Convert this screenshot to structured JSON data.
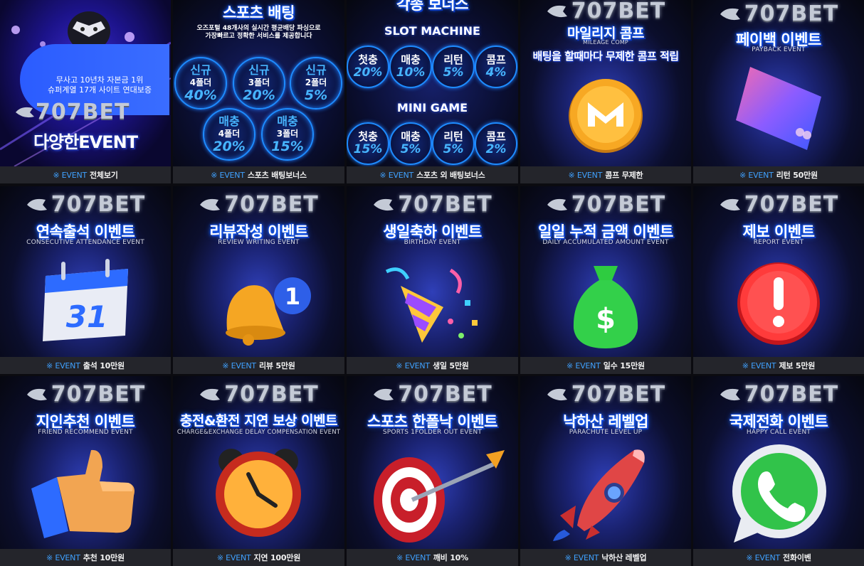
{
  "brand": "707BET",
  "caption_prefix": "※ EVENT",
  "colors": {
    "accent": "#3fa1ff",
    "caption_bg": "#24252b",
    "glow": "#1d6bff"
  },
  "cards": [
    {
      "id": "all",
      "caption": "전체보기",
      "promo_line1": "무사고 10년차 자본금 1위",
      "promo_line2": "슈퍼계열 17개 사이트 연대보증",
      "promo_title": "다양한EVENT",
      "icon": "masked-figure-icon"
    },
    {
      "id": "sports",
      "caption": "스포츠 배팅보너스",
      "title": "스포츠 배팅",
      "desc_line1": "오즈포털 48개사의 실시간 평균배당 파싱으로",
      "desc_line2": "가장빠르고 정확한 서비스를 제공합니다",
      "bonuses": [
        {
          "label": "신규",
          "folder": "4폴더",
          "pct": "40%"
        },
        {
          "label": "신규",
          "folder": "3폴더",
          "pct": "20%"
        },
        {
          "label": "신규",
          "folder": "2폴더",
          "pct": "5%"
        },
        {
          "label": "매충",
          "folder": "4폴더",
          "pct": "20%"
        },
        {
          "label": "매충",
          "folder": "3폴더",
          "pct": "15%"
        }
      ]
    },
    {
      "id": "casino",
      "caption": "스포츠 외 배팅보너스",
      "title": "각종 보너스",
      "slot_label": "SLOT MACHINE",
      "mini_label": "MINI GAME",
      "slot": [
        {
          "label": "첫충",
          "pct": "20%"
        },
        {
          "label": "매충",
          "pct": "10%"
        },
        {
          "label": "리턴",
          "pct": "5%"
        },
        {
          "label": "콤프",
          "pct": "4%"
        }
      ],
      "mini": [
        {
          "label": "첫충",
          "pct": "15%"
        },
        {
          "label": "매충",
          "pct": "5%"
        },
        {
          "label": "리턴",
          "pct": "5%"
        },
        {
          "label": "콤프",
          "pct": "2%"
        }
      ]
    },
    {
      "id": "comp",
      "caption": "콤프 무제한",
      "title": "마일리지 콤프",
      "subtitle": "MILEAGE COMP",
      "tagline": "배팅을 할때마다 무제한 콤프 적립",
      "icon": "coin-icon"
    },
    {
      "id": "payback",
      "caption": "리턴 50만원",
      "title": "페이백 이벤트",
      "subtitle": "PAYBACK EVENT",
      "icon": "credit-card-icon"
    },
    {
      "id": "attendance",
      "caption": "출석 10만원",
      "title": "연속출석 이벤트",
      "subtitle": "CONSECUTIVE ATTENDANCE EVENT",
      "icon": "calendar-icon",
      "calendar_day": "31"
    },
    {
      "id": "review",
      "caption": "리뷰 5만원",
      "title": "리뷰작성 이벤트",
      "subtitle": "REVIEW WRITING EVENT",
      "icon": "bell-icon",
      "badge": "1"
    },
    {
      "id": "birthday",
      "caption": "생일 5만원",
      "title": "생일축하 이벤트",
      "subtitle": "BIRTHDAY EVENT",
      "icon": "party-popper-icon"
    },
    {
      "id": "daily",
      "caption": "일수 15만원",
      "title": "일일 누적 금액 이벤트",
      "subtitle": "DAILY ACCUMULATED AMOUNT EVENT",
      "icon": "money-bag-icon"
    },
    {
      "id": "report",
      "caption": "제보 5만원",
      "title": "제보 이벤트",
      "subtitle": "REPORT EVENT",
      "icon": "alert-icon"
    },
    {
      "id": "friend",
      "caption": "추천 10만원",
      "title": "지인추천 이벤트",
      "subtitle": "FRIEND RECOMMEND EVENT",
      "icon": "thumbs-up-icon"
    },
    {
      "id": "delay",
      "caption": "지연 100만원",
      "title": "충전&환전 지연 보상 이벤트",
      "subtitle": "CHARGE&EXCHANGE DELAY COMPENSATION EVENT",
      "icon": "alarm-clock-icon"
    },
    {
      "id": "onefolder",
      "caption": "깨비 10%",
      "title": "스포츠 한폴낙 이벤트",
      "subtitle": "SPORTS 1FOLDER OUT EVENT",
      "icon": "target-icon"
    },
    {
      "id": "parachute",
      "caption": "낙하산 레벨업",
      "title": "낙하산 레벨업",
      "subtitle": "PARACHUTE LEVEL UP",
      "icon": "rocket-icon"
    },
    {
      "id": "call",
      "caption": "전화이벤",
      "title": "국제전화 이벤트",
      "subtitle": "HAPPY CALL EVENT",
      "icon": "phone-chat-icon"
    }
  ]
}
